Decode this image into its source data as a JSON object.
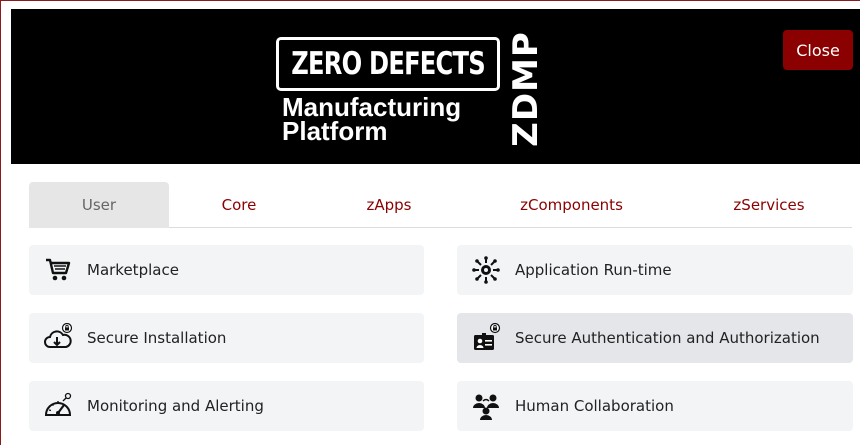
{
  "header": {
    "logo": {
      "title": "ZERO DEFECTS",
      "subtitle_line1": "Manufacturing",
      "subtitle_line2": "Platform",
      "vertical": "ZDMP"
    },
    "close_label": "Close"
  },
  "tabs": [
    {
      "label": "User",
      "active": true
    },
    {
      "label": "Core",
      "active": false
    },
    {
      "label": "zApps",
      "active": false
    },
    {
      "label": "zComponents",
      "active": false
    },
    {
      "label": "zServices",
      "active": false
    }
  ],
  "items": [
    {
      "label": "Marketplace",
      "icon": "cart-icon"
    },
    {
      "label": "Application Run-time",
      "icon": "gear-network-icon"
    },
    {
      "label": "Secure Installation",
      "icon": "cloud-download-lock-icon"
    },
    {
      "label": "Secure Authentication and Authorization",
      "icon": "id-card-lock-icon",
      "highlighted": true
    },
    {
      "label": "Monitoring and Alerting",
      "icon": "speedometer-icon"
    },
    {
      "label": "Human Collaboration",
      "icon": "people-collaboration-icon"
    }
  ],
  "colors": {
    "accent": "#8b0000",
    "header_bg": "#000000",
    "item_bg": "#f3f4f6",
    "active_tab_bg": "#e6e6e6"
  }
}
